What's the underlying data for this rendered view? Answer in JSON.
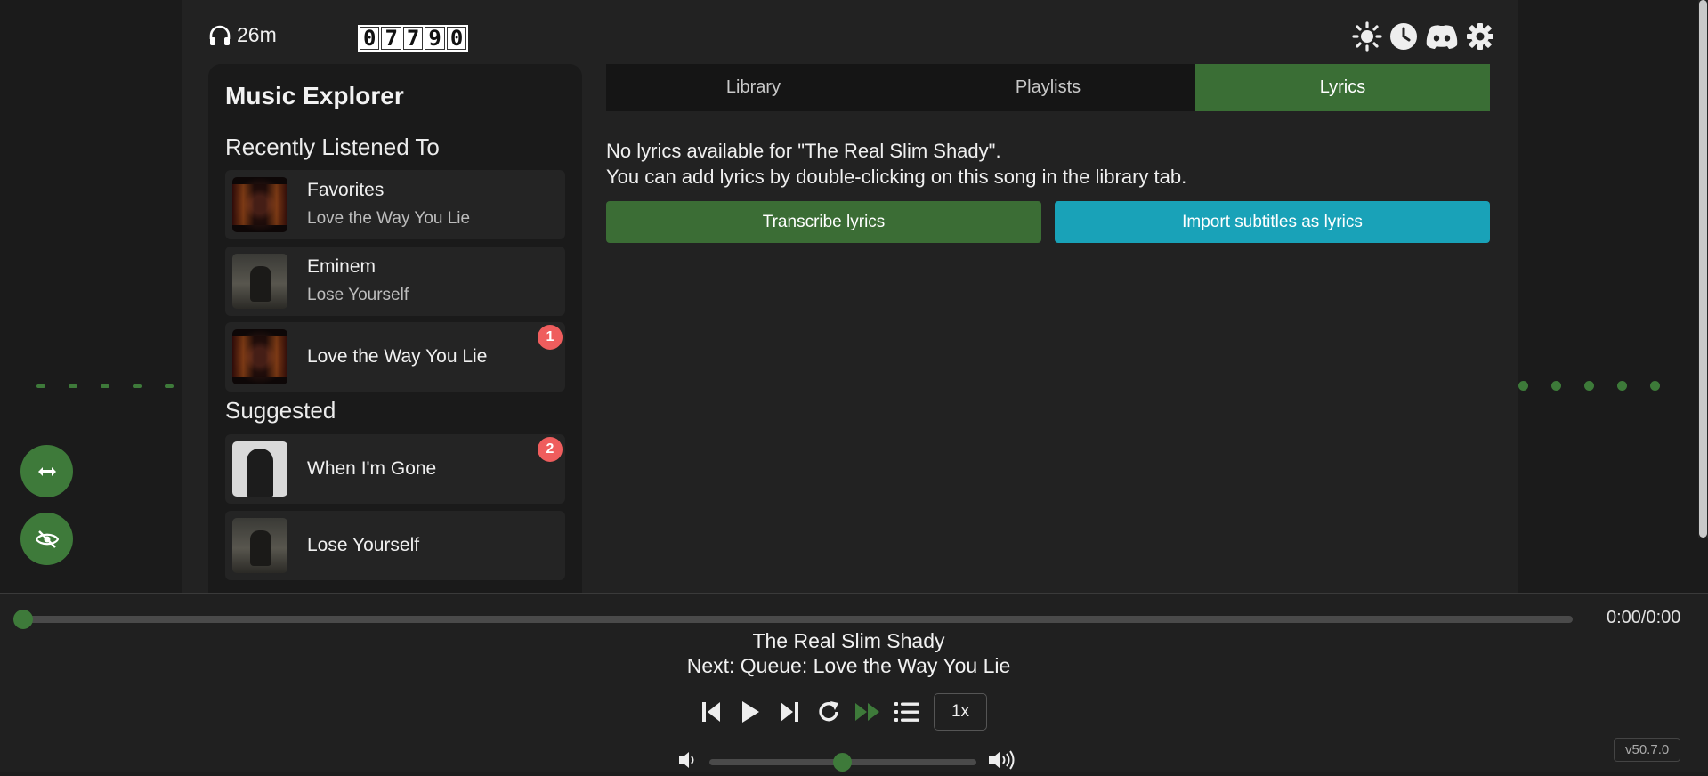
{
  "header": {
    "listen_time": "26m",
    "counter_digits": [
      "0",
      "7",
      "7",
      "9",
      "0"
    ],
    "icons": [
      "sun-icon",
      "clock-icon",
      "discord-icon",
      "gear-icon"
    ]
  },
  "explorer": {
    "title": "Music Explorer",
    "recent_heading": "Recently Listened To",
    "recent": [
      {
        "title": "Favorites",
        "subtitle": "Love the Way You Lie"
      },
      {
        "title": "Eminem",
        "subtitle": "Lose Yourself"
      },
      {
        "title": "Love the Way You Lie",
        "badge": "1"
      }
    ],
    "suggested_heading": "Suggested",
    "suggested": [
      {
        "title": "When I'm Gone",
        "badge": "2"
      },
      {
        "title": "Lose Yourself"
      }
    ]
  },
  "tabs": [
    {
      "label": "Library"
    },
    {
      "label": "Playlists"
    },
    {
      "label": "Lyrics",
      "active": true
    }
  ],
  "lyrics": {
    "message_line1": "No lyrics available for \"The Real Slim Shady\".",
    "message_line2": "You can add lyrics by double-clicking on this song in the library tab.",
    "transcribe_label": "Transcribe lyrics",
    "import_label": "Import subtitles as lyrics"
  },
  "player": {
    "time": "0:00/0:00",
    "now_playing": "The Real Slim Shady",
    "next": "Next: Queue: Love the Way You Lie",
    "speed": "1x",
    "volume": 0.5,
    "version": "v50.7.0"
  },
  "colors": {
    "accent": "#3e7a3a",
    "active_tab": "#3a6e35",
    "import_button": "#19a2b8",
    "badge": "#ef5d5d"
  }
}
